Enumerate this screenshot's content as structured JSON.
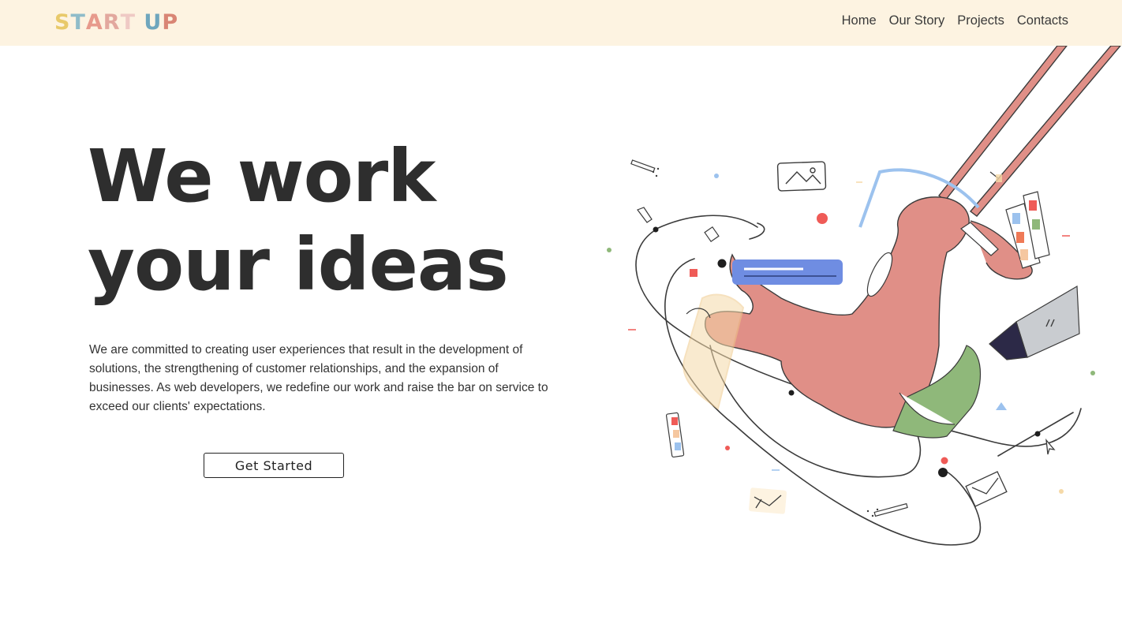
{
  "brand": {
    "letters": [
      {
        "char": "S",
        "color": "#e8c96a"
      },
      {
        "char": "T",
        "color": "#8fbcc9"
      },
      {
        "char": "A",
        "color": "#e79a8c"
      },
      {
        "char": "R",
        "color": "#e2a89e"
      },
      {
        "char": "T",
        "color": "#efc9c4"
      },
      {
        "char": " ",
        "color": "#ffffff"
      },
      {
        "char": "U",
        "color": "#6fa6bd"
      },
      {
        "char": "P",
        "color": "#d98574"
      }
    ]
  },
  "nav": {
    "items": [
      "Home",
      "Our Story",
      "Projects",
      "Contacts"
    ]
  },
  "hero": {
    "title_line1": "We work",
    "title_line2": "your ideas",
    "description": "We are committed to creating user experiences that result in the development of solutions, the strengthening of customer relationships, and the expansion of businesses. As web developers, we redefine our work and raise the bar on service to exceed our clients' expectations.",
    "cta_label": "Get Started"
  },
  "illustration": {
    "icon": "person-on-swing-illustration",
    "colors": {
      "figure": "#e08f87",
      "swing_rope": "#d9847b",
      "message_bar": "#6f8de2",
      "laptop": "#c9ccd0",
      "book": "#8fb87a",
      "paper": "#f5d9a8",
      "accent_red": "#ef5b57",
      "accent_blue": "#9cc2ee"
    }
  }
}
